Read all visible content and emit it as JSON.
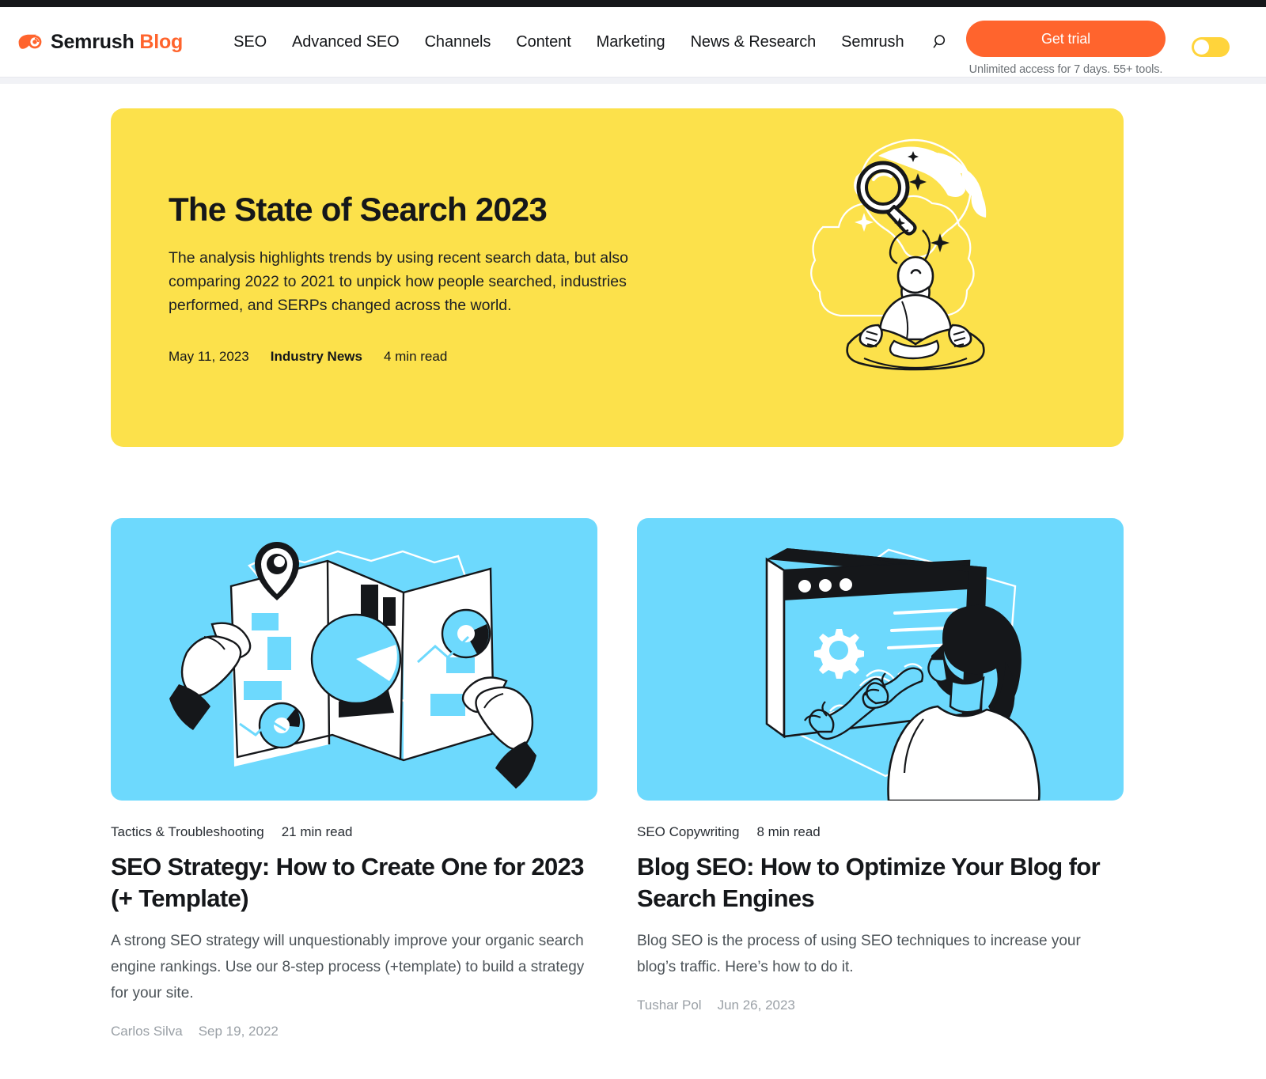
{
  "top_bar": {
    "color": "#15171a"
  },
  "header": {
    "brand": {
      "name": "Semrush",
      "suffix": "Blog",
      "icon": "semrush-comet-logo",
      "accent_color": "#ff642d"
    },
    "nav": [
      {
        "label": "SEO"
      },
      {
        "label": "Advanced SEO"
      },
      {
        "label": "Channels"
      },
      {
        "label": "Content"
      },
      {
        "label": "Marketing"
      },
      {
        "label": "News & Research"
      },
      {
        "label": "Semrush"
      }
    ],
    "search_icon": "search-icon",
    "cta": {
      "label": "Get trial",
      "subtext": "Unlimited access for 7 days. 55+ tools.",
      "color": "#ff642d"
    },
    "theme_toggle": {
      "state": "off",
      "color": "#ffd43b"
    }
  },
  "hero": {
    "title": "The State of Search 2023",
    "description": "The analysis highlights trends by using recent search data, but also comparing 2022 to 2021 to unpick how people searched, industries performed, and SERPs changed across the world.",
    "date": "May 11, 2023",
    "category": "Industry News",
    "read_time": "4 min read",
    "background_color": "#fce14b",
    "illustration": "meditating-person-with-magnifying-glass"
  },
  "cards": [
    {
      "category": "Tactics & Troubleshooting",
      "read_time": "21 min read",
      "title": "SEO Strategy: How to Create One for 2023 (+ Template)",
      "description": "A strong SEO strategy will unquestionably improve your organic search engine rankings. Use our 8-step process (+template) to build a strategy for your site.",
      "author": "Carlos Silva",
      "date": "Sep 19, 2022",
      "background_color": "#6dd9fd",
      "illustration": "hands-holding-folded-map-with-charts-and-pin"
    },
    {
      "category": "SEO Copywriting",
      "read_time": "8 min read",
      "title": "Blog SEO: How to Optimize Your Blog for Search Engines",
      "description": "Blog SEO is the process of using SEO techniques to increase your blog’s traffic. Here’s how to do it.",
      "author": "Tushar Pol",
      "date": "Jun 26, 2023",
      "background_color": "#6dd9fd",
      "illustration": "woman-touching-browser-window-with-gear"
    }
  ]
}
